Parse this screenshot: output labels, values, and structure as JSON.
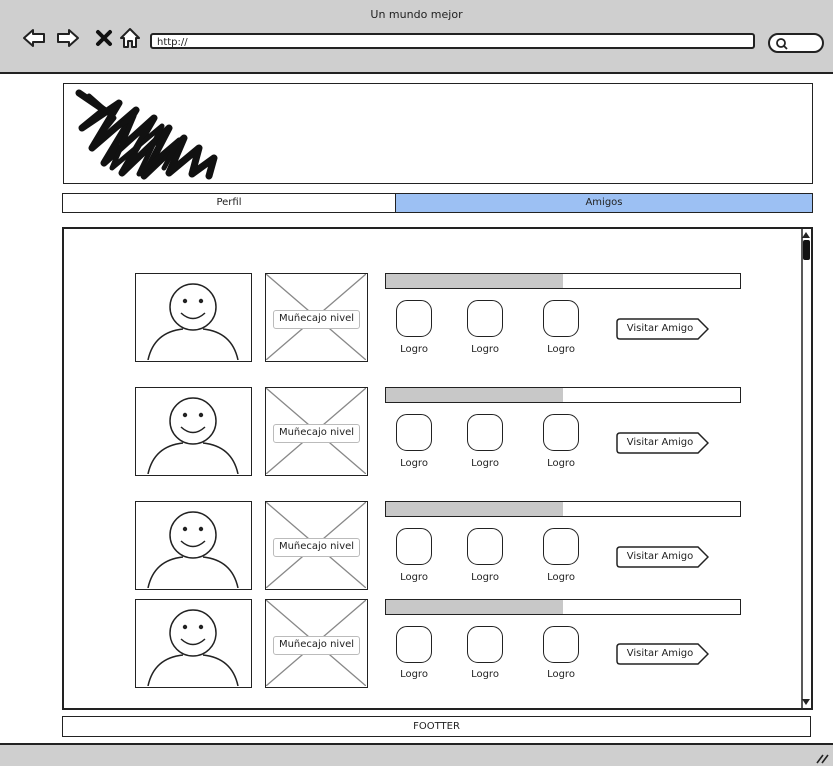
{
  "window": {
    "title": "Un mundo mejor"
  },
  "browser": {
    "url": "http://"
  },
  "tabs": [
    {
      "label": "Perfil",
      "active": false
    },
    {
      "label": "Amigos",
      "active": true,
      "color": "#9cc0f3"
    }
  ],
  "friends": [
    {
      "placeholder_label": "Muñecajo nivel",
      "progress": 0.5,
      "achievements": [
        "Logro",
        "Logro",
        "Logro"
      ],
      "visit_label": "Visitar Amigo"
    },
    {
      "placeholder_label": "Muñecajo nivel",
      "progress": 0.5,
      "achievements": [
        "Logro",
        "Logro",
        "Logro"
      ],
      "visit_label": "Visitar Amigo"
    },
    {
      "placeholder_label": "Muñecajo nivel",
      "progress": 0.5,
      "achievements": [
        "Logro",
        "Logro",
        "Logro"
      ],
      "visit_label": "Visitar Amigo"
    },
    {
      "placeholder_label": "Muñecajo nivel",
      "progress": 0.5,
      "achievements": [
        "Logro",
        "Logro",
        "Logro"
      ],
      "visit_label": "Visitar Amigo"
    }
  ],
  "footer": {
    "label": "FOOTTER"
  },
  "icons": [
    "back-arrow-icon",
    "forward-arrow-icon",
    "close-icon",
    "home-icon",
    "search-icon",
    "scroll-up-icon",
    "scroll-down-icon",
    "resize-grip-icon",
    "scribble-logo"
  ]
}
